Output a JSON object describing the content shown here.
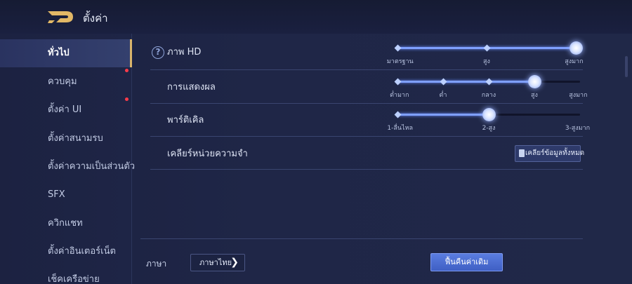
{
  "header": {
    "title": "ตั้งค่า"
  },
  "sidebar": {
    "items": [
      {
        "label": "ทั่วไป"
      },
      {
        "label": "ควบคุม"
      },
      {
        "label": "ตั้งค่า UI"
      },
      {
        "label": "ตั้งค่าสนามรบ"
      },
      {
        "label": "ตั้งค่าความเป็นส่วนตัว"
      },
      {
        "label": "SFX"
      },
      {
        "label": "ควิกแชท"
      },
      {
        "label": "ตั้งค่าอินเตอร์เน็ต"
      },
      {
        "label": "เช็คเครือข่าย"
      }
    ]
  },
  "settings": {
    "hd": {
      "label": "ภาพ HD",
      "help_icon": "?",
      "options": [
        "มาตรฐาน",
        "สูง",
        "สูงมาก"
      ],
      "selected_index": 2
    },
    "display": {
      "label": "การแสดงผล",
      "options": [
        "ต่ำมาก",
        "ต่ำ",
        "กลาง",
        "สูง",
        "สูงมาก"
      ],
      "selected_index": 3
    },
    "particles": {
      "label": "พาร์ติเคิล",
      "options": [
        "1-ลื่นไหล",
        "2-สูง",
        "3-สูงมาก"
      ],
      "selected_index": 1
    },
    "memory": {
      "label": "เคลียร์หน่วยความจำ",
      "button_label": "เคลียร์ข้อมูลทั้งหมด"
    }
  },
  "footer": {
    "language_label": "ภาษา",
    "language_value": "ภาษาไทย",
    "restore_label": "ฟื้นคืนค่าเดิม"
  },
  "colors": {
    "accent": "#7fa0ff",
    "active_tab_marker": "#d9b46b",
    "notification_dot": "#ff3b4a"
  }
}
